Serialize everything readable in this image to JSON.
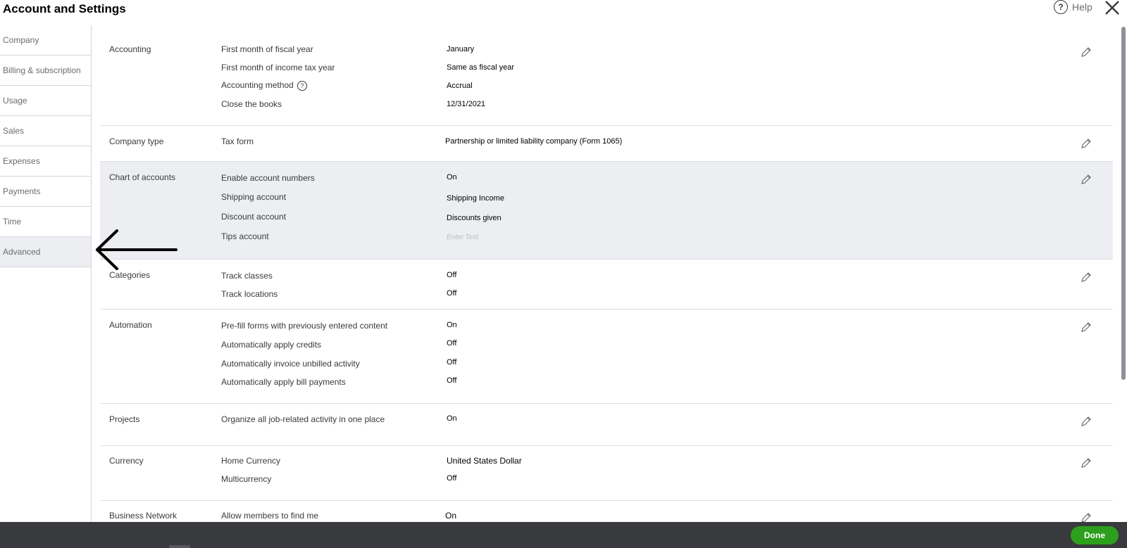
{
  "window": {
    "title": "Account and Settings",
    "help_label": "Help",
    "help_icon_glyph": "?"
  },
  "sidebar": {
    "items": [
      {
        "label": "Company"
      },
      {
        "label": "Billing & subscription"
      },
      {
        "label": "Usage"
      },
      {
        "label": "Sales"
      },
      {
        "label": "Expenses"
      },
      {
        "label": "Payments"
      },
      {
        "label": "Time"
      },
      {
        "label": "Advanced"
      }
    ],
    "active": "Advanced"
  },
  "sections": {
    "accounting": {
      "title": "Accounting",
      "rows": [
        {
          "label": "First month of fiscal year",
          "value": "January"
        },
        {
          "label": "First month of income tax year",
          "value": "Same as fiscal year"
        },
        {
          "label": "Accounting method",
          "value": "Accrual"
        },
        {
          "label": "Close the books",
          "value": "12/31/2021"
        }
      ]
    },
    "company_type": {
      "title": "Company type",
      "rows": [
        {
          "label": "Tax form",
          "value": "Partnership or limited liability company (Form 1065)"
        }
      ]
    },
    "chart_of_accounts": {
      "title": "Chart of accounts",
      "rows": [
        {
          "label": "Enable account numbers",
          "value": "On"
        },
        {
          "label": "Shipping account",
          "value": "Shipping Income"
        },
        {
          "label": "Discount account",
          "value": "Discounts given"
        },
        {
          "label": "Tips account",
          "placeholder": "Enter Text"
        }
      ]
    },
    "categories": {
      "title": "Categories",
      "rows": [
        {
          "label": "Track classes",
          "value": "Off"
        },
        {
          "label": "Track locations",
          "value": "Off"
        }
      ]
    },
    "automation": {
      "title": "Automation",
      "rows": [
        {
          "label": "Pre-fill forms with previously entered content",
          "value": "On"
        },
        {
          "label": "Automatically apply credits",
          "value": "Off"
        },
        {
          "label": "Automatically invoice unbilled activity",
          "value": "Off"
        },
        {
          "label": "Automatically apply bill payments",
          "value": "Off"
        }
      ]
    },
    "projects": {
      "title": "Projects",
      "rows": [
        {
          "label": "Organize all job-related activity in one place",
          "value": "On"
        }
      ]
    },
    "currency": {
      "title": "Currency",
      "rows": [
        {
          "label": "Home Currency",
          "value": "United States Dollar"
        },
        {
          "label": "Multicurrency",
          "value": "Off"
        }
      ]
    },
    "business_network": {
      "title": "Business Network",
      "rows": [
        {
          "label": "Allow members to find me",
          "value": "On"
        }
      ]
    }
  },
  "footer": {
    "done_label": "Done"
  },
  "colors": {
    "done_button": "#2ca01c",
    "footer_bar": "#393a3d",
    "highlight_row": "#eceef1"
  }
}
